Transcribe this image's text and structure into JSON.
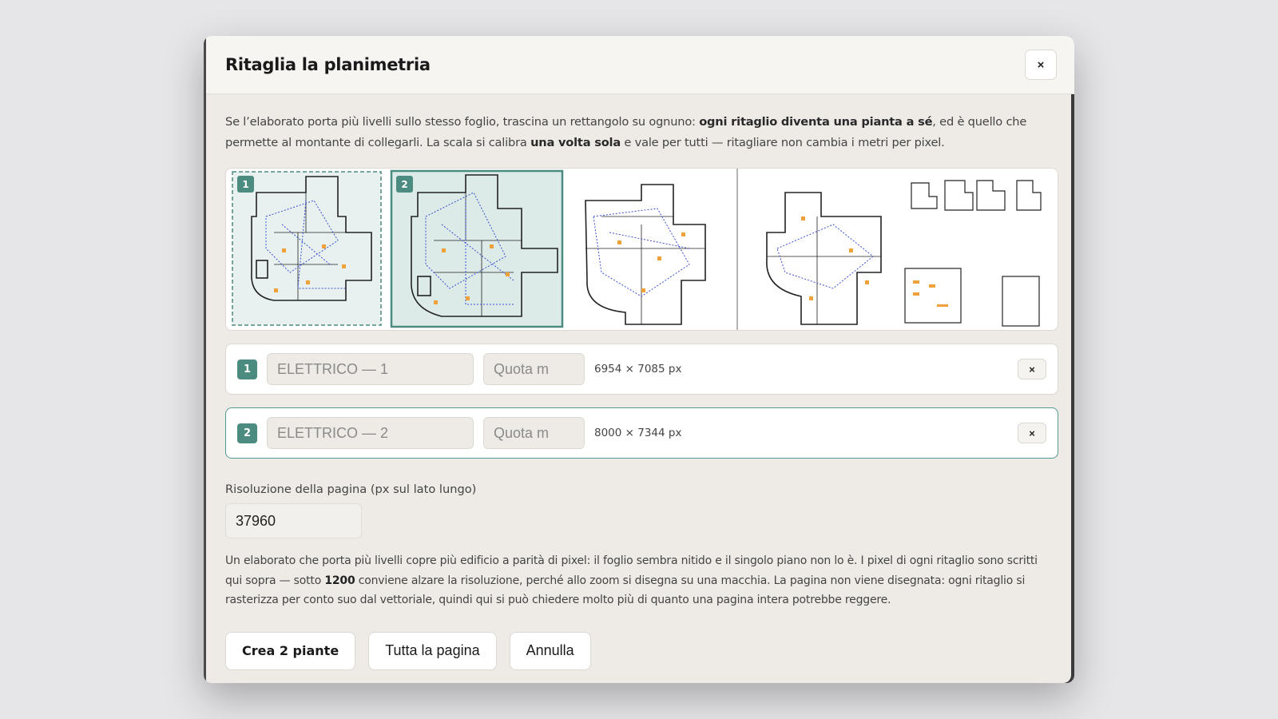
{
  "dialog": {
    "title": "Ritaglia la planimetria",
    "close_label": "×"
  },
  "intro": {
    "part1": "Se l’elaborato porta più livelli sullo stesso foglio, trascina un rettangolo su ognuno: ",
    "bold1": "ogni ritaglio diventa una pianta a sé",
    "part2": ", ed è quello che permette al montante di collegarli. La scala si calibra ",
    "bold2": "una volta sola",
    "part3": " e vale per tutti — ritagliare non cambia i metri per pixel."
  },
  "preview": {
    "selections": [
      "1",
      "2"
    ],
    "colors": {
      "accent": "#4b8b80",
      "wire": "#3a4fd0",
      "device": "#f0a23a"
    }
  },
  "crops": [
    {
      "badge": "1",
      "name_placeholder": "ELETTRICO — 1",
      "quota_placeholder": "Quota m",
      "dims": "6954 × 7085 px",
      "remove_label": "×",
      "active": false
    },
    {
      "badge": "2",
      "name_placeholder": "ELETTRICO — 2",
      "quota_placeholder": "Quota m",
      "dims": "8000 × 7344 px",
      "remove_label": "×",
      "active": true
    }
  ],
  "resolution": {
    "label": "Risoluzione della pagina (px sul lato lungo)",
    "value": "37960"
  },
  "note": {
    "part1": "Un elaborato che porta più livelli copre più edificio a parità di pixel: il foglio sembra nitido e il singolo piano non lo è. I pixel di ogni ritaglio sono scritti qui sopra — sotto ",
    "bold": "1200",
    "part2": " conviene alzare la risoluzione, perché allo zoom si disegna su una macchia. La pagina non viene disegnata: ogni ritaglio si rasterizza per conto suo dal vettoriale, quindi qui si può chiedere molto più di quanto una pagina intera potrebbe reggere."
  },
  "actions": {
    "create": "Crea 2 piante",
    "whole_page": "Tutta la pagina",
    "cancel": "Annulla"
  }
}
